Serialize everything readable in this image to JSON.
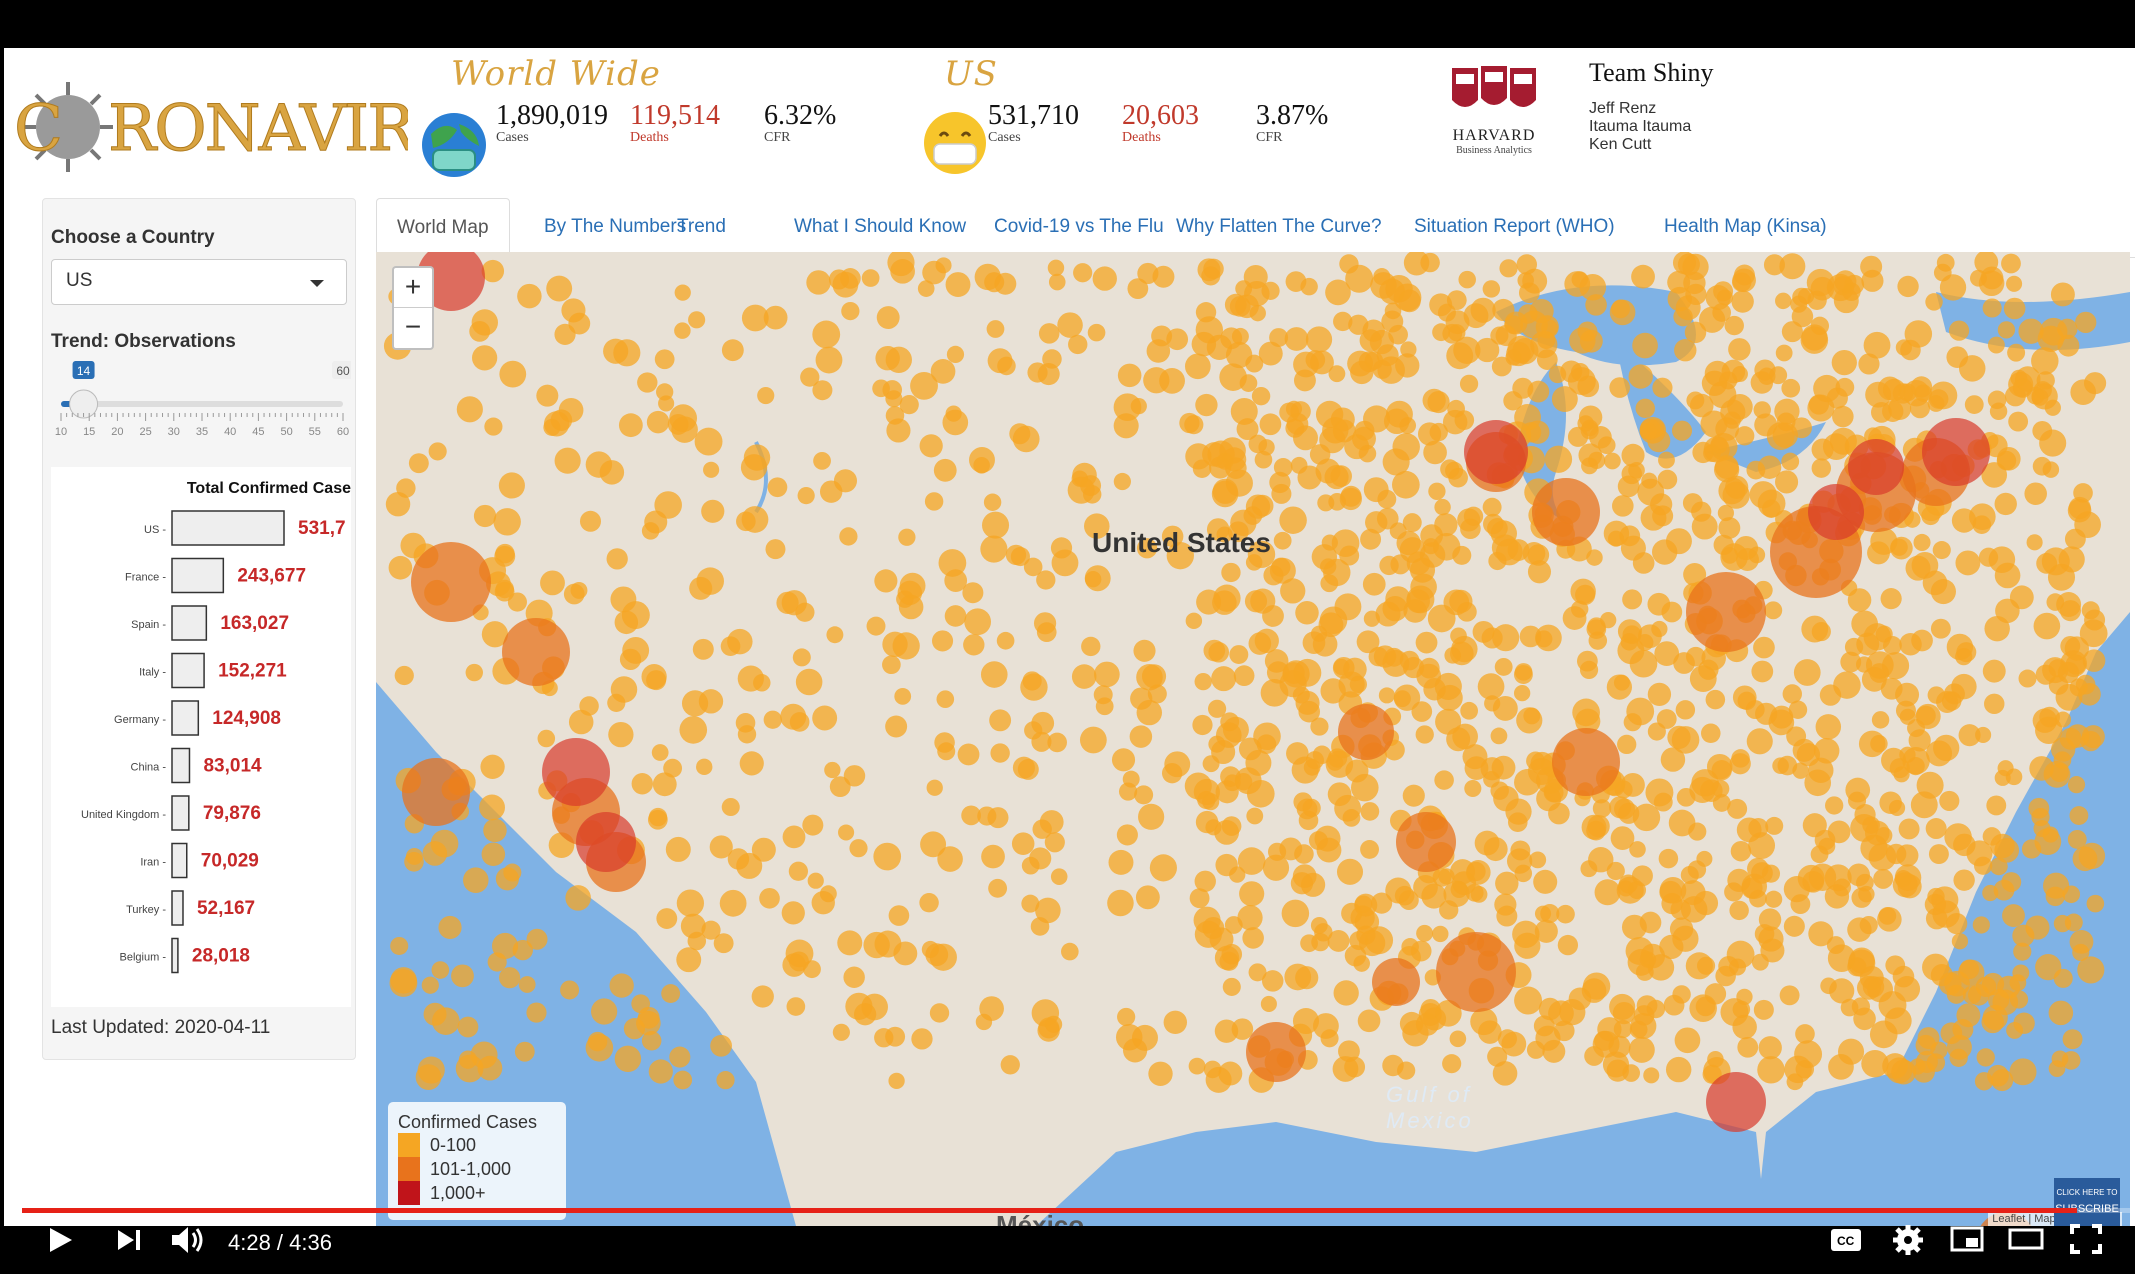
{
  "header": {
    "world_title": "World Wide",
    "world": {
      "cases": "1,890,019",
      "cases_label": "Cases",
      "deaths": "119,514",
      "deaths_label": "Deaths",
      "cfr": "6.32%",
      "cfr_label": "CFR"
    },
    "us_title": "US",
    "us": {
      "cases": "531,710",
      "cases_label": "Cases",
      "deaths": "20,603",
      "deaths_label": "Deaths",
      "cfr": "3.87%",
      "cfr_label": "CFR"
    },
    "harvard": "HARVARD",
    "harvard_sub": "Business Analytics",
    "team_title": "Team Shiny",
    "members": [
      "Jeff Renz",
      "Itauma Itauma",
      "Ken Cutt"
    ]
  },
  "sidebar": {
    "country_label": "Choose a Country",
    "country_value": "US",
    "trend_label": "Trend: Observations",
    "slider": {
      "min_label": "14",
      "max_label": "60",
      "value": 14,
      "min": 10,
      "max": 60,
      "ticks": [
        "10",
        "15",
        "20",
        "25",
        "30",
        "35",
        "40",
        "45",
        "50",
        "55",
        "60"
      ]
    },
    "updated": "Last Updated: 2020-04-11"
  },
  "chart_data": {
    "type": "bar",
    "title": "Total Confirmed Case",
    "categories": [
      "US",
      "France",
      "Spain",
      "Italy",
      "Germany",
      "China",
      "United Kingdom",
      "Iran",
      "Turkey",
      "Belgium"
    ],
    "values": [
      531710,
      243677,
      163027,
      152271,
      124908,
      83014,
      79876,
      70029,
      52167,
      28018
    ],
    "labels": [
      "531,7",
      "243,677",
      "163,027",
      "152,271",
      "124,908",
      "83,014",
      "79,876",
      "70,029",
      "52,167",
      "28,018"
    ]
  },
  "tabs": [
    {
      "label": "World Map",
      "active": true
    },
    {
      "label": "By The Numbers"
    },
    {
      "label": "Trend"
    },
    {
      "label": "What I Should Know"
    },
    {
      "label": "Covid-19 vs The Flu"
    },
    {
      "label": "Why Flatten The Curve?"
    },
    {
      "label": "Situation Report (WHO)"
    },
    {
      "label": "Health Map (Kinsa)"
    }
  ],
  "map": {
    "zoom_in": "+",
    "zoom_out": "−",
    "country_label": "United States",
    "gulf": "Gulf of",
    "gulf2": "Mexico",
    "mexico": "México",
    "attribution": "Leaflet | Maps by Mapbox",
    "legend": {
      "title": "Confirmed Cases",
      "items": [
        {
          "label": "0-100",
          "color": "#f5a623"
        },
        {
          "label": "101-1,000",
          "color": "#e8731c"
        },
        {
          "label": "1,000+",
          "color": "#c0141a"
        }
      ]
    }
  },
  "player": {
    "time": "4:28 / 4:36",
    "progress": 0.974,
    "subscribe": "SUBSCRIBE",
    "click": "CLICK HERE TO"
  }
}
